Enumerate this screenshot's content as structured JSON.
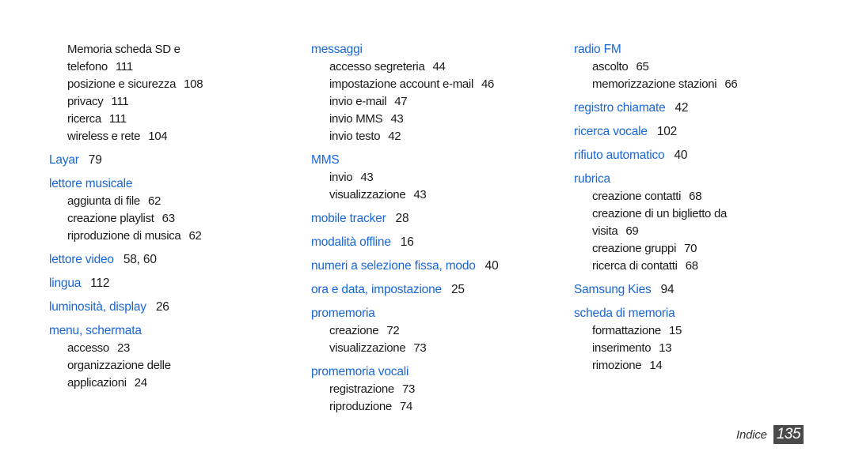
{
  "accent_color": "#1a66d6",
  "columns": [
    {
      "entries": [
        {
          "heading": null,
          "continuation": true,
          "subs": [
            {
              "label": "Memoria scheda SD e",
              "page": ""
            },
            {
              "label": "telefono",
              "page": "111"
            },
            {
              "label": "posizione e sicurezza",
              "page": "108"
            },
            {
              "label": "privacy",
              "page": "111"
            },
            {
              "label": "ricerca",
              "page": "111"
            },
            {
              "label": "wireless e rete",
              "page": "104"
            }
          ]
        },
        {
          "heading": "Layar",
          "page": "79",
          "subs": []
        },
        {
          "heading": "lettore musicale",
          "page": "",
          "subs": [
            {
              "label": "aggiunta di file",
              "page": "62"
            },
            {
              "label": "creazione playlist",
              "page": "63"
            },
            {
              "label": "riproduzione di musica",
              "page": "62"
            }
          ]
        },
        {
          "heading": "lettore video",
          "page": "58, 60",
          "subs": []
        },
        {
          "heading": "lingua",
          "page": "112",
          "subs": []
        },
        {
          "heading": "luminosità, display",
          "page": "26",
          "subs": []
        },
        {
          "heading": "menu, schermata",
          "page": "",
          "subs": [
            {
              "label": "accesso",
              "page": "23"
            },
            {
              "label": "organizzazione delle",
              "page": ""
            },
            {
              "label": "applicazioni",
              "page": "24"
            }
          ]
        }
      ]
    },
    {
      "entries": [
        {
          "heading": "messaggi",
          "page": "",
          "subs": [
            {
              "label": "accesso segreteria",
              "page": "44"
            },
            {
              "label": "impostazione account e-mail",
              "page": "46"
            },
            {
              "label": "invio e-mail",
              "page": "47"
            },
            {
              "label": "invio MMS",
              "page": "43"
            },
            {
              "label": "invio testo",
              "page": "42"
            }
          ]
        },
        {
          "heading": "MMS",
          "page": "",
          "subs": [
            {
              "label": "invio",
              "page": "43"
            },
            {
              "label": "visualizzazione",
              "page": "43"
            }
          ]
        },
        {
          "heading": "mobile tracker",
          "page": "28",
          "subs": []
        },
        {
          "heading": "modalità offline",
          "page": "16",
          "subs": []
        },
        {
          "heading": "numeri a selezione fissa, modo",
          "page": "40",
          "subs": []
        },
        {
          "heading": "ora e data, impostazione",
          "page": "25",
          "subs": []
        },
        {
          "heading": "promemoria",
          "page": "",
          "subs": [
            {
              "label": "creazione",
              "page": "72"
            },
            {
              "label": "visualizzazione",
              "page": "73"
            }
          ]
        },
        {
          "heading": "promemoria vocali",
          "page": "",
          "subs": [
            {
              "label": "registrazione",
              "page": "73"
            },
            {
              "label": "riproduzione",
              "page": "74"
            }
          ]
        }
      ]
    },
    {
      "entries": [
        {
          "heading": "radio FM",
          "page": "",
          "subs": [
            {
              "label": "ascolto",
              "page": "65"
            },
            {
              "label": "memorizzazione stazioni",
              "page": "66"
            }
          ]
        },
        {
          "heading": "registro chiamate",
          "page": "42",
          "subs": []
        },
        {
          "heading": "ricerca vocale",
          "page": "102",
          "subs": []
        },
        {
          "heading": "rifiuto automatico",
          "page": "40",
          "subs": []
        },
        {
          "heading": "rubrica",
          "page": "",
          "subs": [
            {
              "label": "creazione contatti",
              "page": "68"
            },
            {
              "label": "creazione di un biglietto da",
              "page": ""
            },
            {
              "label": "visita",
              "page": "69"
            },
            {
              "label": "creazione gruppi",
              "page": "70"
            },
            {
              "label": "ricerca di contatti",
              "page": "68"
            }
          ]
        },
        {
          "heading": "Samsung Kies",
          "page": "94",
          "subs": []
        },
        {
          "heading": "scheda di memoria",
          "page": "",
          "subs": [
            {
              "label": "formattazione",
              "page": "15"
            },
            {
              "label": "inserimento",
              "page": "13"
            },
            {
              "label": "rimozione",
              "page": "14"
            }
          ]
        }
      ]
    }
  ],
  "footer": {
    "section": "Indice",
    "page_number": "135"
  }
}
